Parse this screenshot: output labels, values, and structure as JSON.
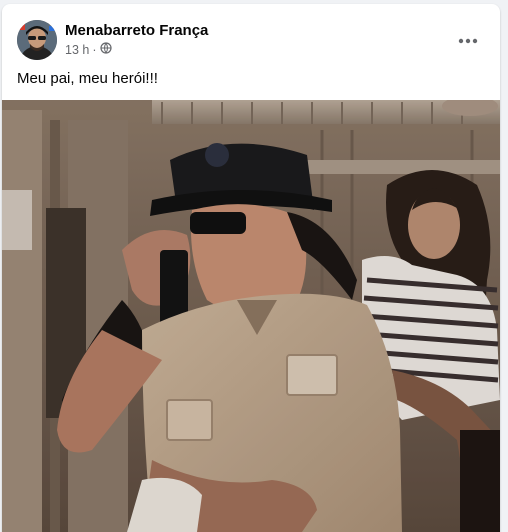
{
  "post": {
    "author": "Menabarreto França",
    "time": "13 h",
    "separator": "·",
    "privacy_icon": "globe-icon",
    "caption": "Meu pai, meu herói!!!",
    "more_icon": "more-options-icon"
  }
}
